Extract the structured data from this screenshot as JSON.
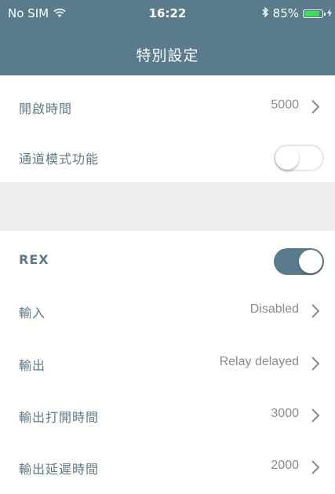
{
  "status_bar": {
    "carrier": "No SIM",
    "time": "16:22",
    "battery_percent": "85%",
    "battery_level": 0.85
  },
  "nav": {
    "title": "特別設定"
  },
  "rows": [
    {
      "label": "開啟時間",
      "value": "5000"
    },
    {
      "label": "通道模式功能",
      "toggle": "off"
    },
    {
      "label": "REX",
      "toggle": "on"
    },
    {
      "label": "輸入",
      "value": "Disabled"
    },
    {
      "label": "輸出",
      "value": "Relay delayed"
    },
    {
      "label": "輸出打開時間",
      "value": "3000"
    },
    {
      "label": "輸出延遲時間",
      "value": "2000"
    }
  ],
  "colors": {
    "accent": "#5a7b8c",
    "label": "#5f7886",
    "value": "#8a8a8a",
    "section_gap": "#efefef",
    "battery_fill": "#35e05a"
  }
}
